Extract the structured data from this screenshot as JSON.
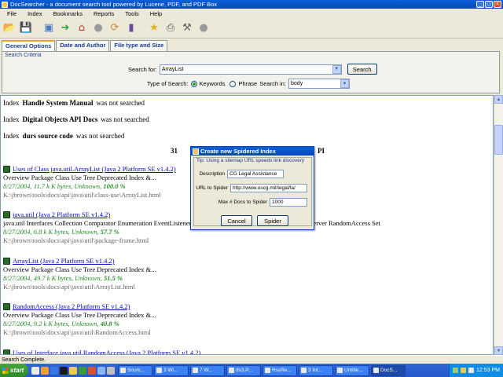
{
  "window": {
    "title": "DocSearcher - a document search tool powered by Lucene, PDF, and PDF Box"
  },
  "menu": [
    "File",
    "Index",
    "Bookmarks",
    "Reports",
    "Tools",
    "Help"
  ],
  "toolbar": [
    {
      "name": "open-icon",
      "glyph": "📂",
      "color": "#3a6fb0"
    },
    {
      "name": "save-icon",
      "glyph": "💾",
      "color": "#3a6fb0"
    },
    {
      "name": "import-icon",
      "glyph": "▣",
      "color": "#4a78c8"
    },
    {
      "name": "forward-icon",
      "glyph": "➜",
      "color": "#2ea043"
    },
    {
      "name": "home-icon",
      "glyph": "⌂",
      "color": "#c0392b"
    },
    {
      "name": "stop-icon",
      "glyph": "●",
      "color": "#9a9a9a"
    },
    {
      "name": "refresh-icon",
      "glyph": "⟳",
      "color": "#d9822b"
    },
    {
      "name": "book-icon",
      "glyph": "▮",
      "color": "#6a4a9a"
    },
    {
      "name": "bookmark-star-icon",
      "glyph": "★",
      "color": "#e3b31b"
    },
    {
      "name": "print-icon",
      "glyph": "⎙",
      "color": "#555555"
    },
    {
      "name": "tools-icon",
      "glyph": "⚒",
      "color": "#666666"
    },
    {
      "name": "exit-icon",
      "glyph": "●",
      "color": "#9a9a9a"
    }
  ],
  "tabs": [
    "General Options",
    "Date and Author",
    "File type and Size"
  ],
  "criteria": {
    "legend": "Search Criteria",
    "search_label": "Search for:",
    "search_value": "ArrayList",
    "search_button": "Search",
    "type_label": "Type of Search:",
    "keywords_label": "Keywords",
    "phrase_label": "Phrase",
    "search_in_label": "Search in:",
    "search_in_value": "body"
  },
  "notices": [
    {
      "prefix": "Index",
      "name": "Handle System Manual",
      "suffix": "was not searched"
    },
    {
      "prefix": "Index",
      "name": "Digital Objects API Docs",
      "suffix": "was not searched"
    },
    {
      "prefix": "Index",
      "name": "durs source code",
      "suffix": "was not searched"
    }
  ],
  "results_header": {
    "count": "31",
    "tail": "PI"
  },
  "results": [
    {
      "title": "Uses of Class java.util.ArrayList (Java 2 Platform SE v1.4.2)",
      "snippet": "Overview   Package   Class   Use   Tree   Deprecated   Index &...",
      "date_size": "8/27/2004, 11.7 k K bytes, Unknown,",
      "score": "100.0 %",
      "path": "K:\\jbrown\\tools\\docs\\api\\java\\util\\class-use\\ArrayList.html"
    },
    {
      "title": "java.util (Java 2 Platform SE v1.4.2)",
      "snippet": "java.util Interfaces   Collection Comparator Enumeration EventListener Iterator List ListIterator Map Map.Entry Observer RandomAccess Set",
      "date_size": "8/27/2004, 6.8 k K bytes, Unknown,",
      "score": "57.7 %",
      "path": "K:\\jbrown\\tools\\docs\\api\\java\\util\\package-frame.html"
    },
    {
      "title": "ArrayList (Java 2 Platform SE v1.4.2)",
      "snippet": "Overview   Package   Class   Use   Tree   Deprecated   Index &...",
      "date_size": "8/27/2004, 49.7 k K bytes, Unknown,",
      "score": "51.5 %",
      "path": "K:\\jbrown\\tools\\docs\\api\\java\\util\\ArrayList.html"
    },
    {
      "title": "RandomAccess (Java 2 Platform SE v1.4.2)",
      "snippet": "Overview   Package   Class   Use   Tree   Deprecated   Index &...",
      "date_size": "8/27/2004, 9.2 k K bytes, Unknown,",
      "score": "40.8 %",
      "path": "K:\\jbrown\\tools\\docs\\api\\java\\util\\RandomAccess.html"
    },
    {
      "title": "Uses of Interface java.util.RandomAccess (Java 2 Platform SE v1.4.2)",
      "snippet": "",
      "date_size": "",
      "score": "",
      "path": ""
    }
  ],
  "dialog": {
    "title": "Create new Spidered Index",
    "tip": "Tip: Using a sitemap URL speeds link discovery",
    "description_label": "Description",
    "description_value": "CG Legal Assistance",
    "url_label": "URL to Spider",
    "url_value": "http://www.uscg.mil/legal/la/",
    "max_label": "Max # Docs to Spider",
    "max_value": "1000",
    "cancel": "Cancel",
    "spider": "Spider"
  },
  "status": "Search Complete.",
  "taskbar": {
    "start": "start",
    "quicklaunch": [
      "#e8e8e8",
      "#f0a030",
      "#3b78e7",
      "#1a1a1a",
      "#f2c94c",
      "#3a9a3a",
      "#d9532c",
      "#8ab4f8",
      "#c0c0c0"
    ],
    "tasks": [
      "Sourc...",
      "3 Wi...",
      "7 W...",
      "ds3.P...",
      "RssRe...",
      "3 Int...",
      "Untitle...",
      "DocS..."
    ],
    "time": "12:53 PM"
  }
}
